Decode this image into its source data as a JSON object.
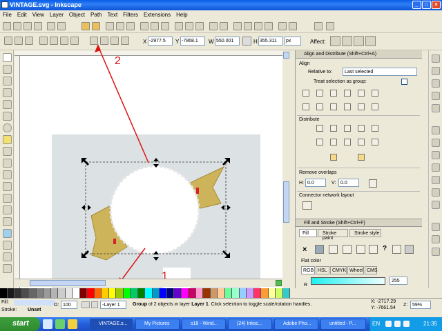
{
  "window": {
    "title": "VINTAGE.svg - Inkscape",
    "controls": [
      "_",
      "□",
      "×"
    ]
  },
  "menu": [
    "File",
    "Edit",
    "View",
    "Layer",
    "Object",
    "Path",
    "Text",
    "Filters",
    "Extensions",
    "Help"
  ],
  "toolcontrols": {
    "x_label": "X",
    "x_value": "-2977.5",
    "y_label": "Y",
    "y_value": "-7868.1",
    "w_label": "W",
    "w_value": "550.001",
    "h_label": "H",
    "h_value": "355.311",
    "unit": "px",
    "affect_label": "Affect:"
  },
  "annotations": {
    "one": "1",
    "two": "2",
    "arrow_color": "#dd1111"
  },
  "align": {
    "title": "Align and Distribute (Shift+Ctrl+A)",
    "align_section": "Align",
    "relative_label": "Relative to:",
    "relative_value": "Last selected",
    "treat_group": "Treat selection as group:",
    "distribute_section": "Distribute",
    "overlaps_section": "Remove overlaps",
    "h_label": "H:",
    "h_value": "0.0",
    "v_label": "V:",
    "v_value": "0.0",
    "connector_section": "Connector network layout"
  },
  "fillstroke": {
    "title": "Fill and Stroke (Shift+Ctrl+F)",
    "tabs": [
      "Fill",
      "Stroke paint",
      "Stroke style"
    ],
    "flat_color": "Flat color",
    "modes": [
      "RGB",
      "HSL",
      "CMYK",
      "Wheel",
      "CMS"
    ],
    "alpha_value": "255",
    "channel": "R",
    "accent": "#20f0f0"
  },
  "palette": [
    "#000000",
    "#1a1a1a",
    "#333333",
    "#4d4d4d",
    "#666666",
    "#808080",
    "#999999",
    "#b3b3b3",
    "#cccccc",
    "#e6e6e6",
    "#ffffff",
    "#800000",
    "#ff0000",
    "#ff6600",
    "#ffcc00",
    "#ffff00",
    "#99cc00",
    "#00ff00",
    "#00cc66",
    "#008000",
    "#00ffff",
    "#0099cc",
    "#0000ff",
    "#000080",
    "#6600cc",
    "#ff00ff",
    "#cc0066",
    "#ff99cc",
    "#993300",
    "#cc9966",
    "#ffcc99",
    "#66ff99",
    "#99ffcc",
    "#99ccff",
    "#cc99ff",
    "#ff3366",
    "#ff9933",
    "#ffff99",
    "#ccff66",
    "#33cccc"
  ],
  "status": {
    "fill_label": "Fill:",
    "stroke_label": "Stroke:",
    "stroke_value": "Unset",
    "o_label": "O:",
    "o_value": "100",
    "layer": "-Layer 1",
    "message_b": "Group",
    "message": " of 2 objects in layer ",
    "message_b2": "Layer 1",
    "message2": ". Click selection to toggle scale/rotation handles.",
    "coord_x": "X: -2717.29",
    "coord_y": "Y: -7661.54",
    "zoom_label": "Z:",
    "zoom_value": "59%"
  },
  "taskbar": {
    "start": "start",
    "tasks": [
      "VINTAGE.s...",
      "My Pictures",
      "s18 - Wind...",
      "(24) Inksc...",
      "Adobe Pho...",
      "untitled - P..."
    ],
    "lang": "EN",
    "time": "21:35"
  }
}
